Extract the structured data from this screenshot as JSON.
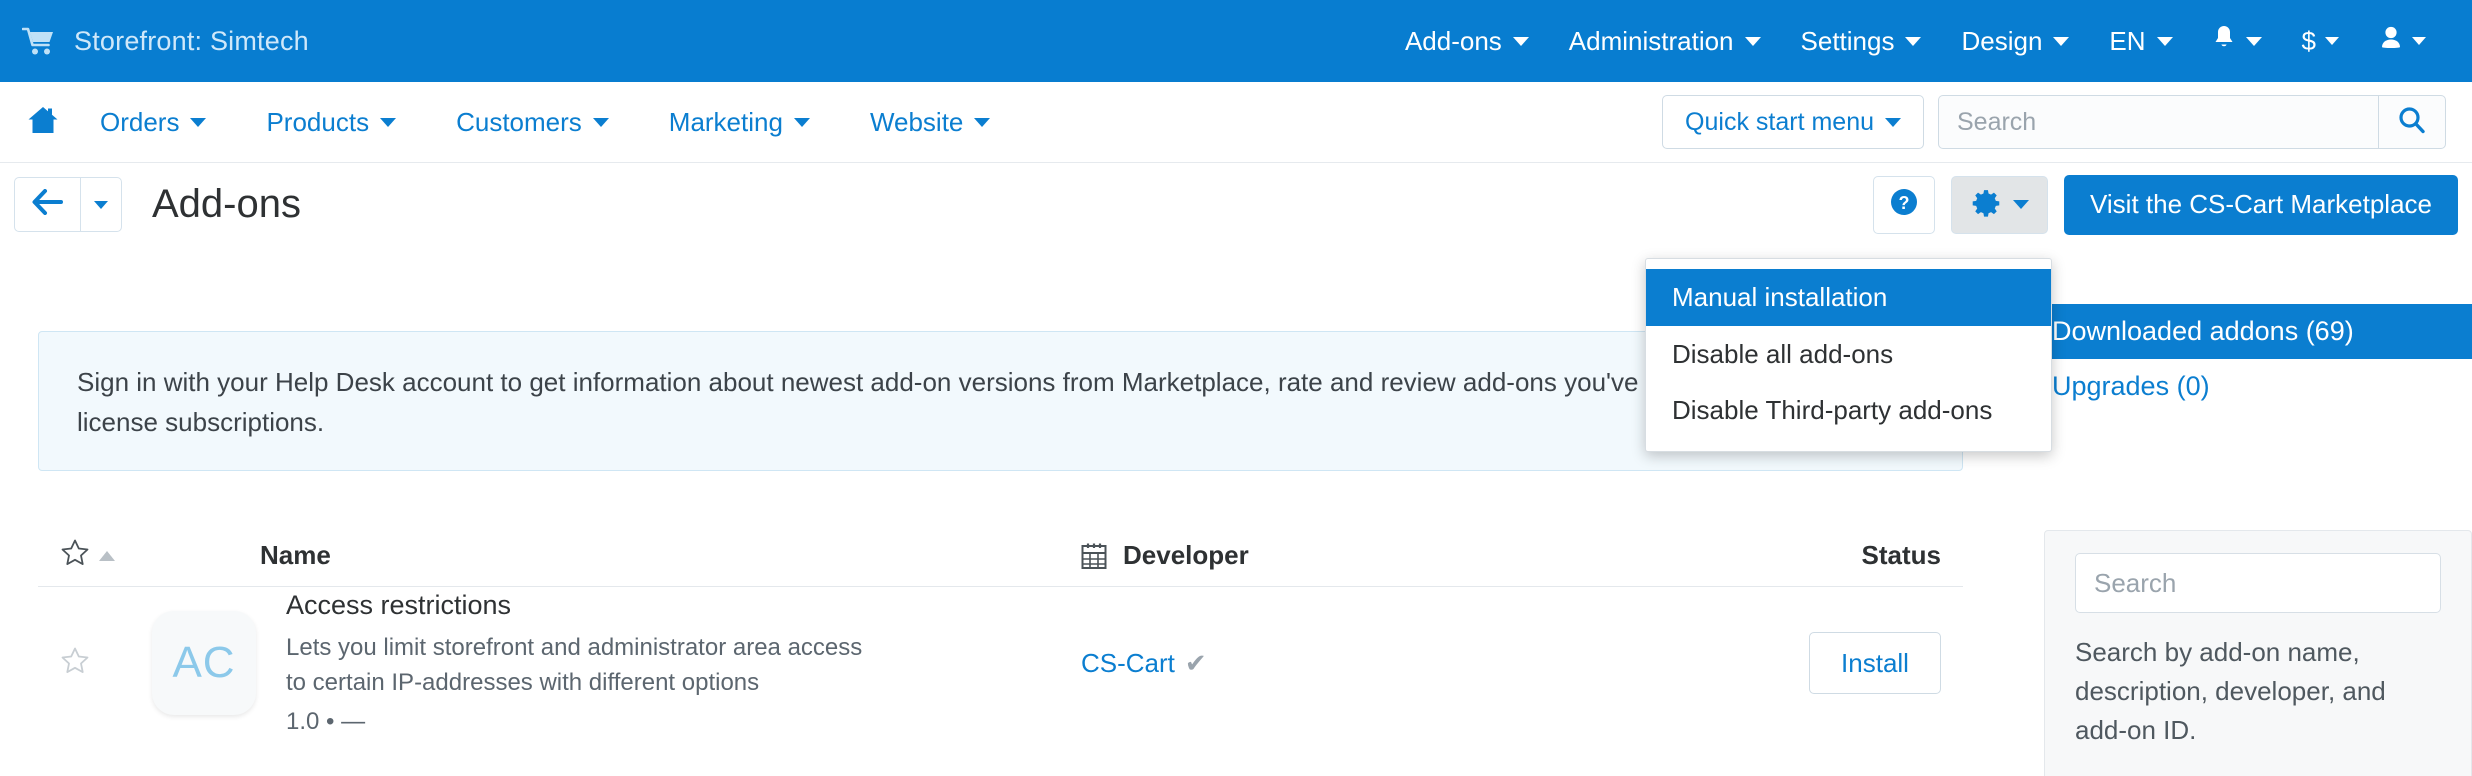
{
  "topbar": {
    "brand": "Storefront: Simtech",
    "cart_icon": "shopping-cart-icon",
    "links": [
      {
        "label": "Add-ons",
        "caret": true
      },
      {
        "label": "Administration",
        "caret": true
      },
      {
        "label": "Settings",
        "caret": true
      },
      {
        "label": "Design",
        "caret": true
      },
      {
        "label": "EN",
        "caret": true
      }
    ],
    "bell_icon": "bell-icon",
    "currency_label": "$",
    "user_icon": "user-icon"
  },
  "navbar": {
    "home_icon": "home-icon",
    "links": [
      {
        "label": "Orders"
      },
      {
        "label": "Products"
      },
      {
        "label": "Customers"
      },
      {
        "label": "Marketing"
      },
      {
        "label": "Website"
      }
    ],
    "quick_start_label": "Quick start menu",
    "search_placeholder": "Search",
    "search_value": "",
    "search_icon": "search-icon"
  },
  "titlebar": {
    "back_icon": "arrow-left-icon",
    "title": "Add-ons",
    "help_icon": "question-mark-icon",
    "gear_icon": "gear-icon",
    "marketplace_label": "Visit the CS-Cart Marketplace"
  },
  "dropdown": {
    "items": [
      {
        "label": "Manual installation",
        "active": true
      },
      {
        "label": "Disable all add-ons",
        "active": false
      },
      {
        "label": "Disable Third-party add-ons",
        "active": false
      }
    ]
  },
  "notice": {
    "text": "Sign in with your Help Desk account to get information about newest add-on versions from Marketplace, rate and review add-ons you've and prolong your license subscriptions."
  },
  "table": {
    "headers": {
      "star": "star-icon",
      "name": "Name",
      "developer": "Developer",
      "developer_icon": "calendar-icon",
      "status": "Status"
    },
    "rows": [
      {
        "star": "star-outline-icon",
        "logo_initials": "AC",
        "name": "Access restrictions",
        "description": "Lets you limit storefront and administrator area access to certain IP-addresses with different options",
        "version": "1.0 • —",
        "developer": "CS-Cart",
        "verified_icon": "check-icon",
        "action_label": "Install"
      }
    ]
  },
  "sidebar": {
    "tabs": [
      {
        "label": "Downloaded addons (69)",
        "active": true
      },
      {
        "label": "Upgrades (0)",
        "active": false
      }
    ],
    "search_placeholder": "Search",
    "search_value": "",
    "search_hint": "Search by add-on name, description, developer, and add-on ID."
  },
  "colors": {
    "brand_blue": "#087dd0",
    "link_blue": "#0b7ed0",
    "notice_bg": "#f2f9fd",
    "notice_border": "#cfe6f4",
    "logo_initials": "#8cc9ea"
  }
}
